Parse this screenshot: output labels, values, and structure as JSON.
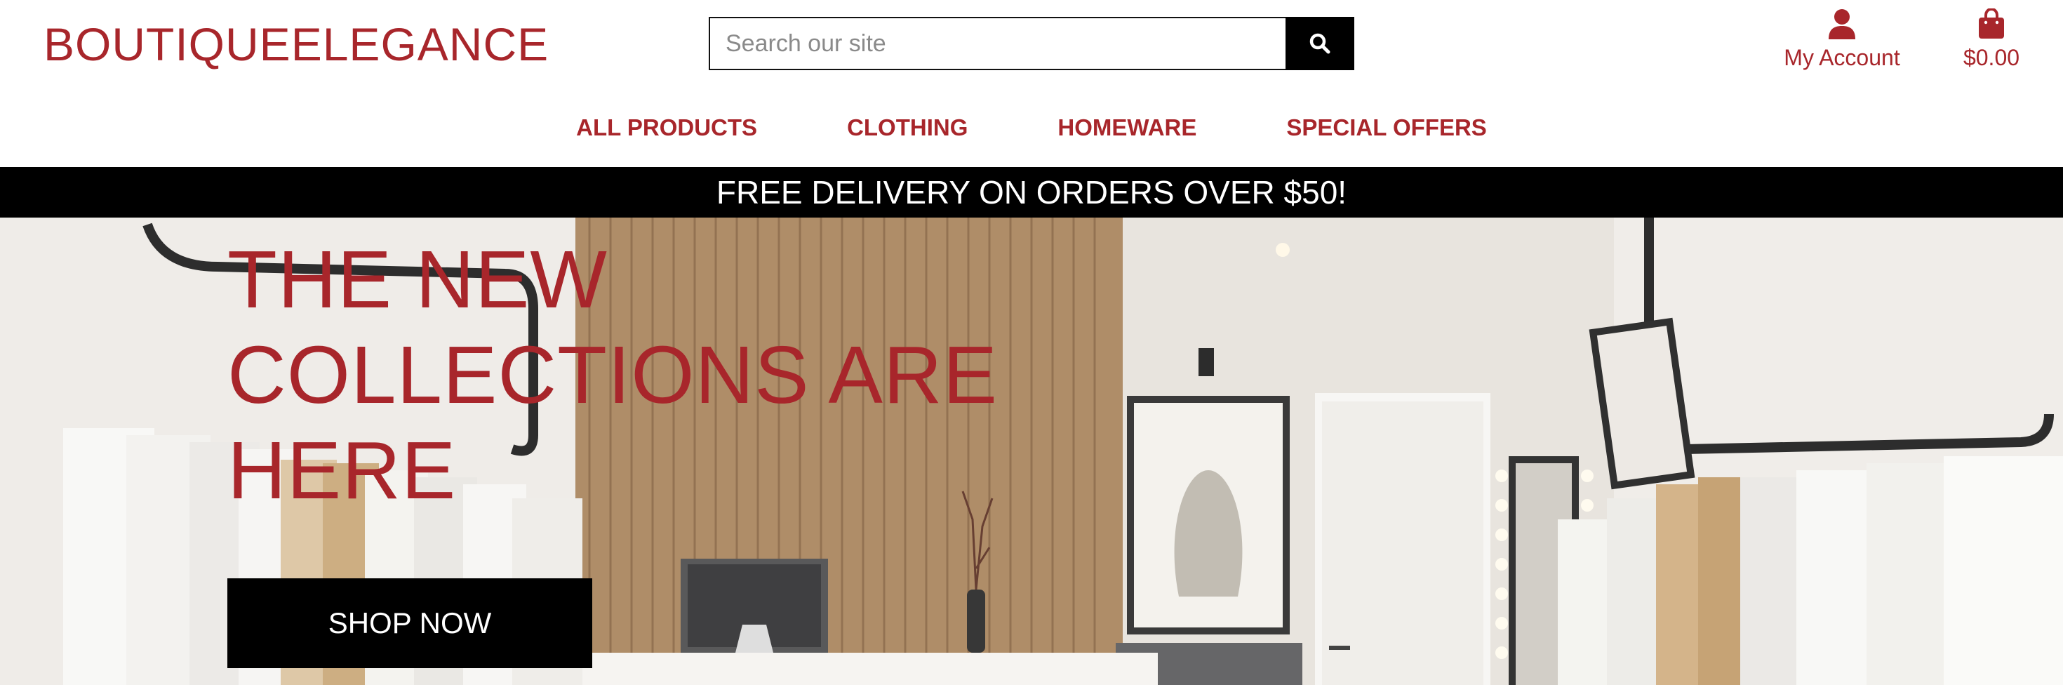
{
  "brand": {
    "name": "BOUTIQUEELEGANCE"
  },
  "search": {
    "placeholder": "Search our site",
    "icon": "search-icon"
  },
  "account": {
    "label": "My Account",
    "icon": "user-icon"
  },
  "cart": {
    "total": "$0.00",
    "icon": "shopping-bag-icon"
  },
  "nav": {
    "items": [
      {
        "label": "ALL PRODUCTS"
      },
      {
        "label": "CLOTHING"
      },
      {
        "label": "HOMEWARE"
      },
      {
        "label": "SPECIAL OFFERS"
      }
    ]
  },
  "banner": {
    "text": "FREE DELIVERY ON ORDERS OVER $50!"
  },
  "hero": {
    "title": "THE NEW COLLECTIONS ARE HERE",
    "cta": "SHOP NOW"
  },
  "colors": {
    "brand": "#a8262b",
    "banner_bg": "#000000",
    "banner_text": "#ffffff"
  }
}
